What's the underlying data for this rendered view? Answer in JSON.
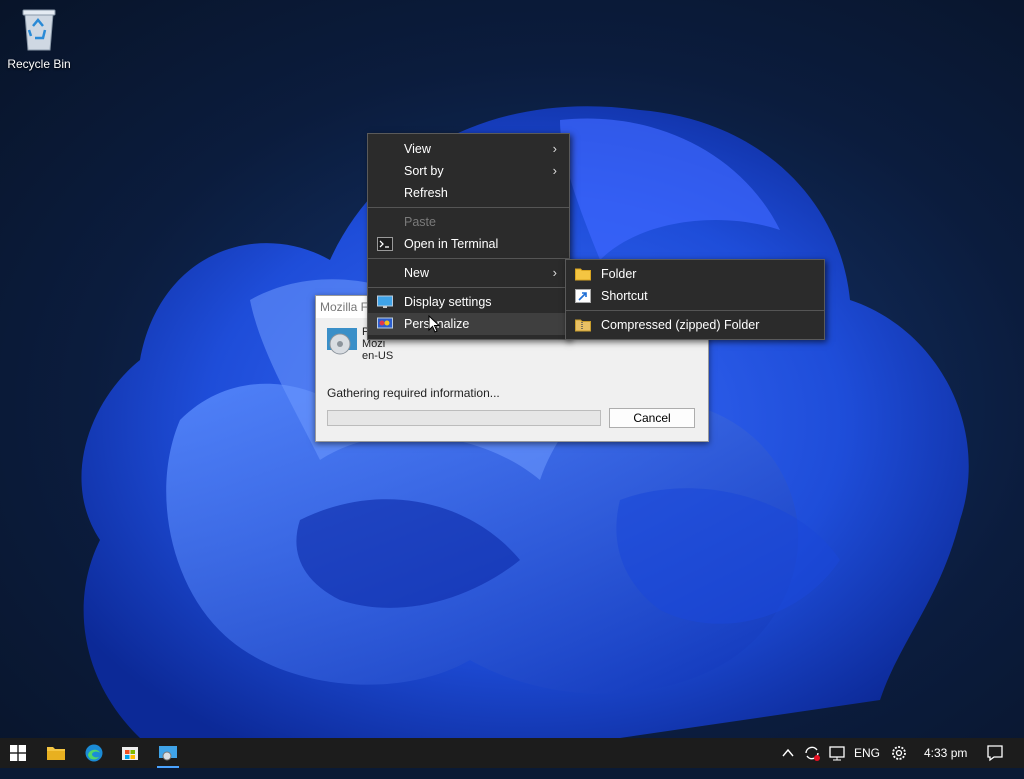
{
  "desktop": {
    "recycle_bin_label": "Recycle Bin"
  },
  "dialog": {
    "title": "Mozilla F",
    "message_line1": "Please wait while Windows configures Mozi",
    "message_line2": "en-US",
    "status": "Gathering required information...",
    "progress_fraction": 0,
    "cancel_label": "Cancel"
  },
  "context_menu": {
    "items": [
      {
        "label": "View",
        "submenu": true
      },
      {
        "label": "Sort by",
        "submenu": true
      },
      {
        "label": "Refresh"
      },
      {
        "label": "Paste",
        "disabled": true
      },
      {
        "label": "Open in Terminal",
        "icon": "terminal-icon"
      },
      {
        "label": "New",
        "submenu": true
      },
      {
        "label": "Display settings",
        "icon": "display-settings-icon"
      },
      {
        "label": "Personalize",
        "icon": "personalize-icon"
      }
    ]
  },
  "new_submenu": {
    "items": [
      {
        "label": "Folder",
        "icon": "folder-icon"
      },
      {
        "label": "Shortcut",
        "icon": "shortcut-icon"
      },
      {
        "label": "Compressed (zipped) Folder",
        "icon": "zip-folder-icon"
      }
    ]
  },
  "taskbar": {
    "language": "ENG",
    "time": "4:33 pm"
  },
  "colors": {
    "menu_bg": "#2b2b2b",
    "taskbar_bg": "#1c1c1c",
    "accent": "#4aa3ff"
  }
}
